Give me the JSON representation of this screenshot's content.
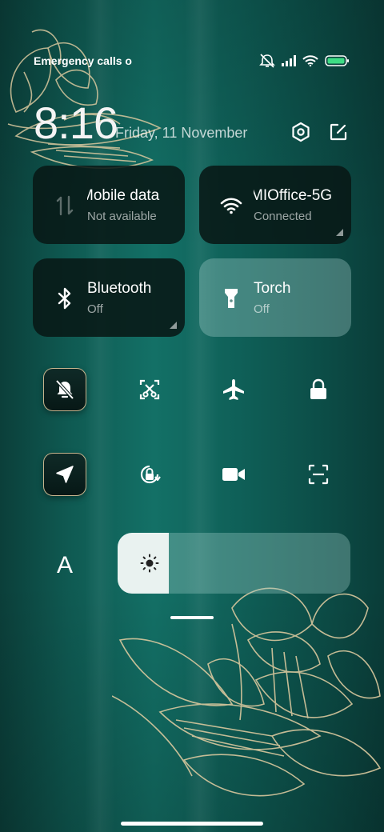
{
  "status_bar": {
    "carrier_text": "Emergency calls o",
    "battery_level": 1.0
  },
  "header": {
    "time": "8:16",
    "date": "Friday, 11 November"
  },
  "tiles": {
    "mobile_data": {
      "title": "Mobile data",
      "status": "Not available"
    },
    "wifi": {
      "title": "MIOffice-5G",
      "status": "Connected"
    },
    "bluetooth": {
      "title": "Bluetooth",
      "status": "Off"
    },
    "torch": {
      "title": "Torch",
      "status": "Off"
    }
  },
  "font_size_button": {
    "label": "A"
  },
  "brightness": {
    "level": 0.22
  },
  "colors": {
    "tile_dark": "#08181699",
    "accent_gold": "#c7b58e",
    "background": "#0f5a52"
  },
  "icons": [
    "mute-icon",
    "signal-icon",
    "wifi-icon",
    "battery-icon",
    "settings-icon",
    "edit-icon",
    "mobile-data-icon",
    "bluetooth-icon",
    "torch-icon",
    "silent-icon",
    "screenshot-icon",
    "airplane-icon",
    "lock-icon",
    "location-icon",
    "rotation-lock-icon",
    "screen-record-icon",
    "scanner-icon",
    "sun-icon"
  ]
}
